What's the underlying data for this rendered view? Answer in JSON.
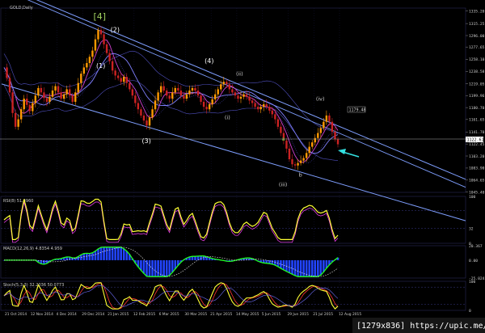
{
  "chart_data": [
    {
      "type": "line",
      "panel": "main",
      "title": "GOLD,Daily",
      "ylim": [
        1045,
        1340
      ],
      "y_ticks": [
        "1335.20",
        "1315.25",
        "1296.00",
        "1277.65",
        "1258.10",
        "1238.58",
        "1219.05",
        "1199.96",
        "1180.70",
        "1161.65",
        "1141.70",
        "1122.45",
        "1103.20",
        "1083.90",
        "1064.65",
        "1045.40"
      ],
      "x_ticks": [
        "21 Oct 2014",
        "12 Nov 2014",
        "4 Dec 2014",
        "29 Dec 2014",
        "21 Jan 2015",
        "12 Feb 2015",
        "6 Mar 2015",
        "30 Mar 2015",
        "21 Apr 2015",
        "14 May 2015",
        "5 Jun 2015",
        "29 Jun 2015",
        "21 Jul 2015",
        "12 Aug 2015"
      ],
      "series": [
        {
          "values": [
            1245,
            1228,
            1205,
            1172,
            1150,
            1162,
            1178,
            1195,
            1185,
            1175,
            1188,
            1200,
            1212,
            1205,
            1196,
            1190,
            1198,
            1208,
            1215,
            1205,
            1195,
            1202,
            1210,
            1200,
            1190,
            1205,
            1220,
            1235,
            1245,
            1252,
            1262,
            1272,
            1290,
            1305,
            1298,
            1282,
            1268,
            1255,
            1240,
            1232,
            1228,
            1222,
            1230,
            1220,
            1210,
            1200,
            1188,
            1178,
            1168,
            1160,
            1152,
            1165,
            1178,
            1192,
            1205,
            1215,
            1208,
            1200,
            1195,
            1205,
            1212,
            1208,
            1200,
            1195,
            1202,
            1208,
            1212,
            1208,
            1200,
            1190,
            1182,
            1178,
            1186,
            1194,
            1202,
            1210,
            1218,
            1222,
            1218,
            1210,
            1205,
            1200,
            1195,
            1198,
            1202,
            1198,
            1192,
            1188,
            1182,
            1178,
            1182,
            1186,
            1182,
            1176,
            1170,
            1162,
            1150,
            1140,
            1128,
            1115,
            1098,
            1090,
            1088,
            1092,
            1096,
            1100,
            1108,
            1118,
            1125,
            1132,
            1140,
            1148,
            1158,
            1168,
            1158,
            1142,
            1130,
            1122
          ]
        }
      ],
      "annotations": [
        "[4]",
        "(2)",
        "(1)",
        "(3)",
        "(4)",
        "(ii)",
        "(i)",
        "a",
        "b",
        "(iii)",
        "(iv)"
      ],
      "price_tags": [
        "1179.48",
        "1122.61"
      ]
    },
    {
      "type": "line",
      "panel": "rsi",
      "title": "RSI(8) 51.4960",
      "y_ticks": [
        "100",
        "32",
        "0"
      ],
      "ylim": [
        0,
        100
      ]
    },
    {
      "type": "bar",
      "panel": "macd",
      "title": "MACD(12,26,9) 4.8354 4.959",
      "y_ticks": [
        "20.367",
        "0.00",
        "-25.024"
      ],
      "ylim": [
        -25.024,
        20.367
      ]
    },
    {
      "type": "line",
      "panel": "stoch",
      "title": "Stoch(5,3,3) 32.2036 50.0773",
      "y_ticks": [
        "100",
        "0"
      ],
      "ylim": [
        0,
        100
      ]
    }
  ],
  "watermark": "[1279x836] https://upic.me/",
  "colors": {
    "background": "#000000",
    "grid": "#16163a",
    "channel": "#7f9fff",
    "bull": "#ff9900",
    "bear": "#cc2222",
    "ma_fast": "#d040d0",
    "ma_slow": "#8080ff",
    "bands": "#5050c0",
    "rsi": "#ffff33",
    "macd_hist": "#2244ff",
    "macd_line": "#22ff22",
    "stoch_main": "#ffff33",
    "stoch_signal": "#ff3333",
    "arrow": "#33e0e0",
    "label_wave": "#ffffff",
    "label_four": "#a0d060"
  }
}
